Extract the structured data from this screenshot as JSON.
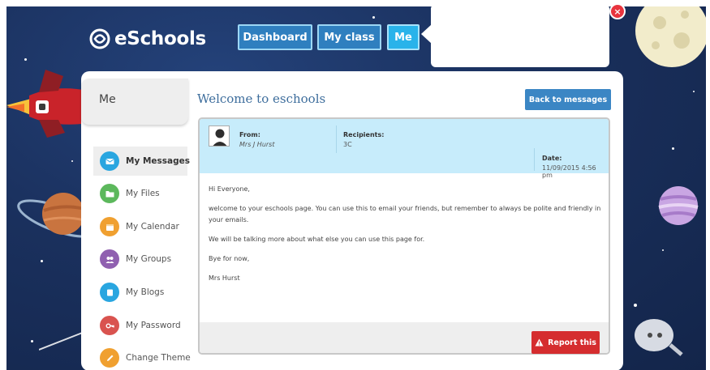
{
  "brand": {
    "name": "eSchools"
  },
  "nav": {
    "dashboard": "Dashboard",
    "my_class": "My class",
    "me": "Me"
  },
  "popup": {
    "close_glyph": "×"
  },
  "section_title": "Me",
  "sidebar": {
    "items": [
      {
        "label": "My Messages",
        "icon": "envelope-icon",
        "color": "#29a6e0"
      },
      {
        "label": "My Files",
        "icon": "folder-icon",
        "color": "#5cb85c"
      },
      {
        "label": "My Calendar",
        "icon": "calendar-icon",
        "color": "#f0a030"
      },
      {
        "label": "My Groups",
        "icon": "group-icon",
        "color": "#9060b0"
      },
      {
        "label": "My Blogs",
        "icon": "blog-icon",
        "color": "#29a6e0"
      },
      {
        "label": "My Password",
        "icon": "key-icon",
        "color": "#d9534f"
      },
      {
        "label": "Change Theme",
        "icon": "pencil-icon",
        "color": "#f0a030"
      }
    ]
  },
  "main": {
    "title": "Welcome to eschools",
    "back_button": "Back to messages"
  },
  "message": {
    "from_label": "From:",
    "from_value": "Mrs J Hurst",
    "recipients_label": "Recipients:",
    "recipients_value": "3C",
    "date_label": "Date:",
    "date_value": "11/09/2015 4:56 pm",
    "greeting": "Hi Everyone,",
    "paragraph_1": "welcome to your eschools page. You can use this to email your friends, but remember to always be polite and friendly in your emails.",
    "paragraph_2": "We will be talking more about what else you can use this page for.",
    "signoff": "Bye for now,",
    "signature": "Mrs Hurst",
    "report_button": "Report this"
  },
  "colors": {
    "background": "#1a305d",
    "nav_button": "#2f7fbf",
    "nav_active": "#29b3ea",
    "header_bg": "#c7ecfb",
    "report_red": "#d52d2f"
  }
}
